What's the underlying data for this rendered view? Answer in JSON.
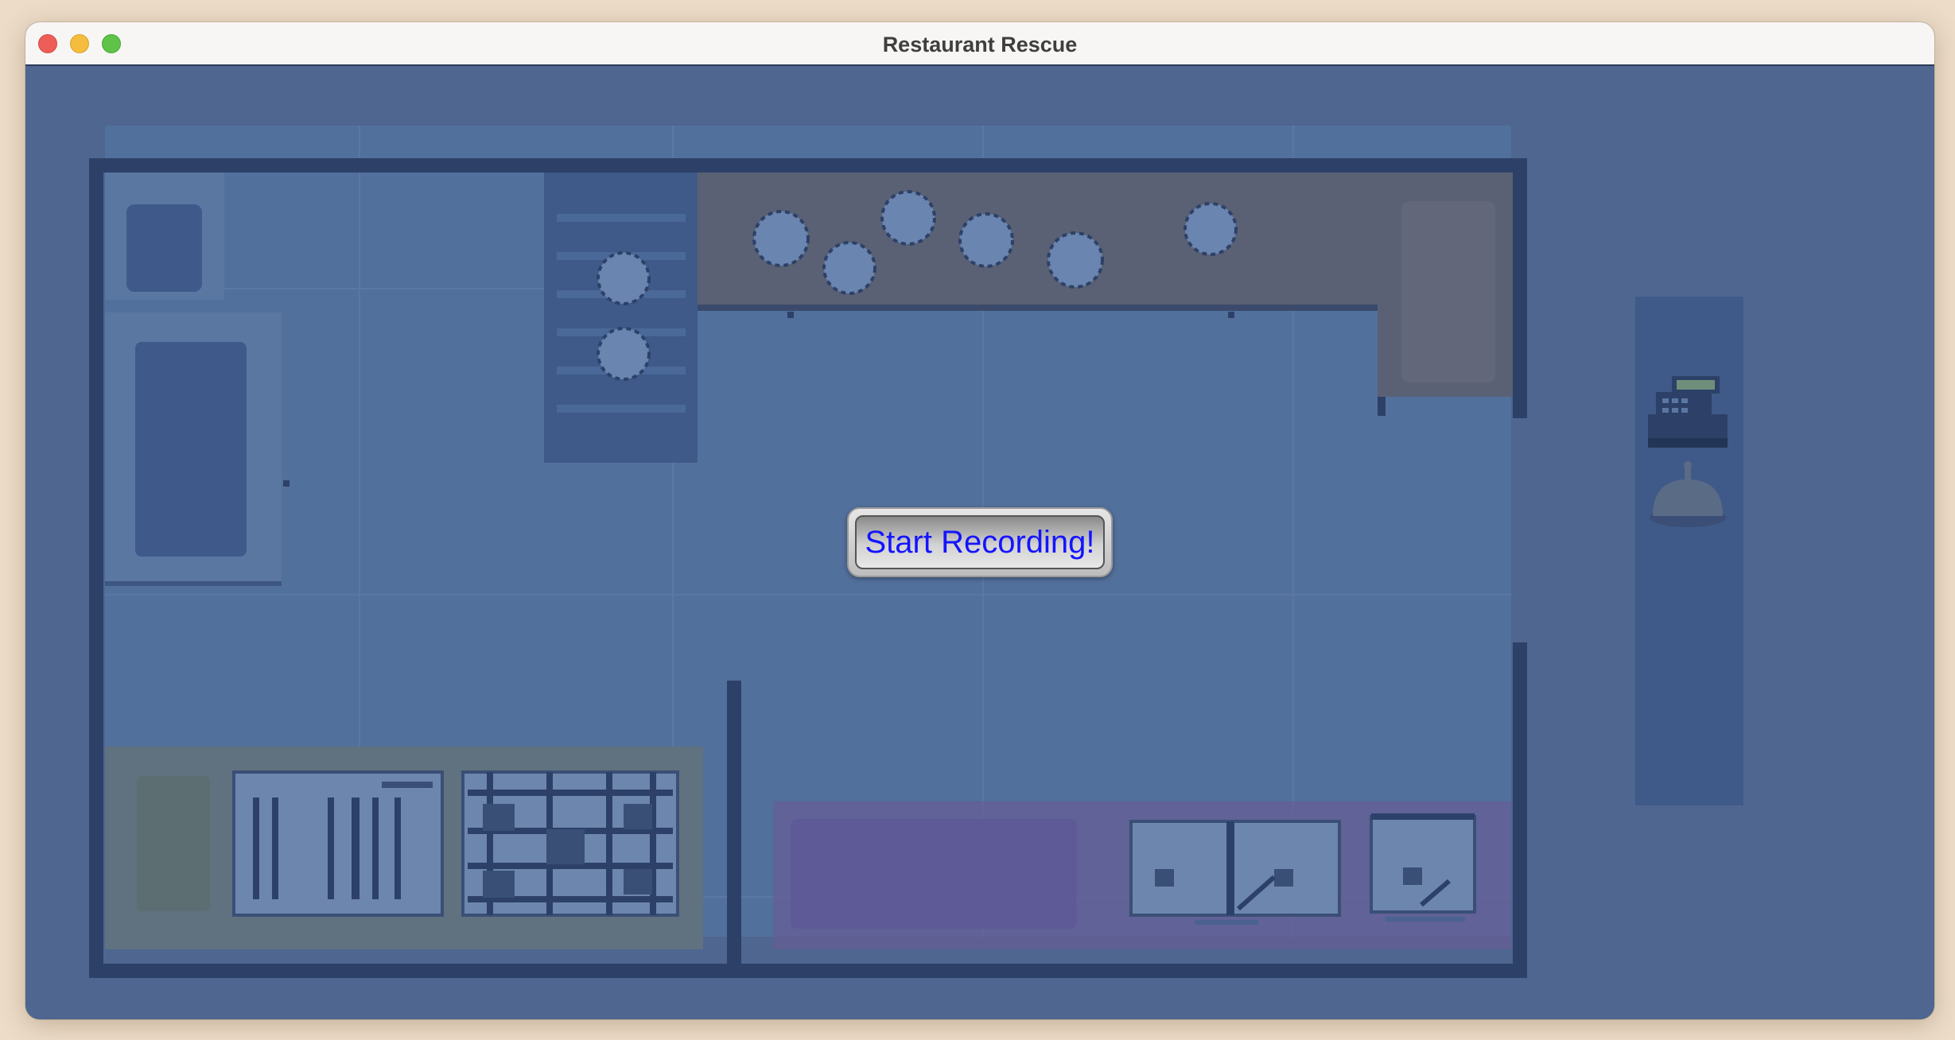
{
  "window": {
    "title": "Restaurant Rescue"
  },
  "overlay": {
    "start_button_label": "Start Recording!"
  },
  "colors": {
    "overlay_tint": "#4e6690",
    "wall": "#2d4168",
    "button_text": "#1414ff",
    "floor": "#52709c"
  },
  "icons": [
    "cash-register-icon",
    "service-bell-icon"
  ]
}
